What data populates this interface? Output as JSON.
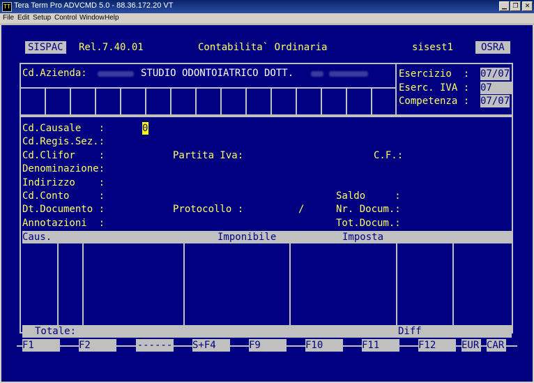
{
  "window": {
    "title": "Tera Term Pro ADVCMD 5.0 - 88.36.172.20 VT",
    "icon": "teraterm-icon",
    "controls": [
      "minimize",
      "maximize",
      "close"
    ]
  },
  "menu": [
    "File",
    "Edit",
    "Setup",
    "Control",
    "Window",
    "Help"
  ],
  "header": {
    "app": "SISPAC",
    "release": "Rel.7.40.01",
    "title": "Contabilita` Ordinaria",
    "user": "sisest1",
    "mode": "OSRA"
  },
  "company": {
    "label": "Cd.Azienda:",
    "name": "STUDIO ODONTOIATRICO DOTT."
  },
  "period": {
    "esercizio_label": "Esercizio  :",
    "esercizio_value": "07/07",
    "iva_label": "Eserc. IVA :",
    "iva_value": "07",
    "competenza_label": "Competenza :",
    "competenza_value": "07/07"
  },
  "form": {
    "causale_label": "Cd.Causale   :",
    "causale_value": "0",
    "regis_label": "Cd.Regis.Sez.:",
    "clifor_label": "Cd.Clifor    :",
    "piva_label": "Partita Iva:",
    "cf_label": "C.F.:",
    "denominazione_label": "Denominazione:",
    "indirizzo_label": "Indirizzo    :",
    "conto_label": "Cd.Conto     :",
    "saldo_label": "Saldo     :",
    "documento_label": "Dt.Documento :",
    "protocollo_label": "Protocollo :",
    "protocollo_sep": "/",
    "nrdoc_label": "Nr. Docum.:",
    "annotazioni_label": "Annotazioni  :",
    "totdoc_label": "Tot.Docum.:"
  },
  "table": {
    "col_caus": "Caus.",
    "col_imponibile": "Imponibile",
    "col_imposta": "Imposta"
  },
  "footer": {
    "totale": "Totale:",
    "diff": "Diff"
  },
  "fkeys": [
    "F1",
    "F2",
    "------",
    "S+F4",
    "F9",
    "F10",
    "F11",
    "F12",
    "EUR",
    "CAR"
  ]
}
